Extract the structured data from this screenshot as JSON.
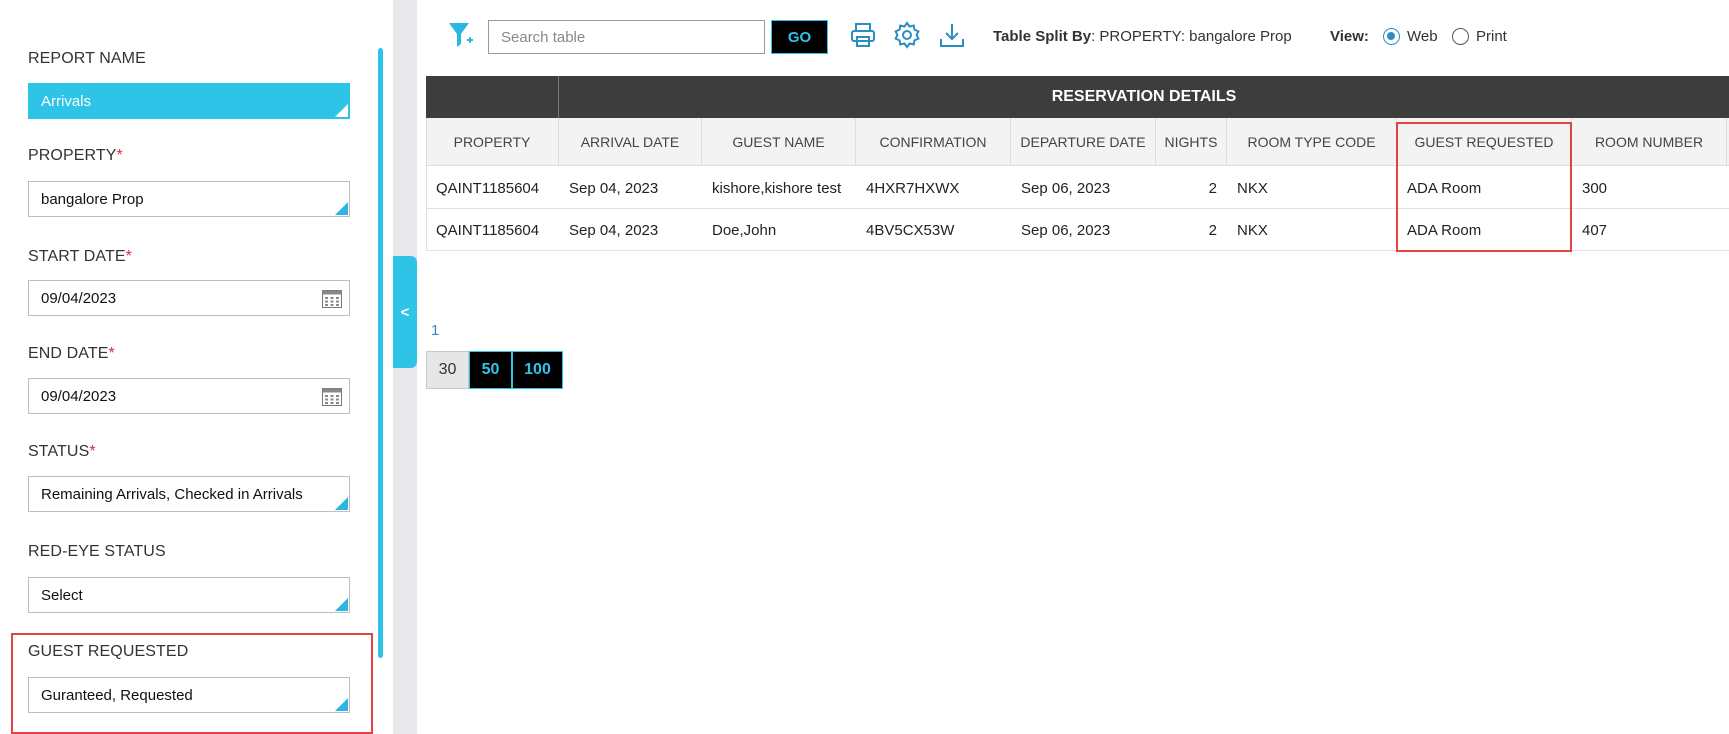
{
  "filters": {
    "report_name": {
      "label": "REPORT NAME",
      "value": "Arrivals"
    },
    "property": {
      "label": "PROPERTY",
      "required": "*",
      "value": "bangalore Prop"
    },
    "start_date": {
      "label": "START DATE",
      "required": "*",
      "value": "09/04/2023"
    },
    "end_date": {
      "label": "END DATE",
      "required": "*",
      "value": "09/04/2023"
    },
    "status": {
      "label": "STATUS",
      "required": "*",
      "value": "Remaining Arrivals, Checked in Arrivals"
    },
    "red_eye_status": {
      "label": "RED-EYE STATUS",
      "value": "Select"
    },
    "guest_requested": {
      "label": "GUEST REQUESTED",
      "value": "Guranteed, Requested"
    }
  },
  "panel": {
    "collapse_label": "<"
  },
  "toolbar": {
    "search_placeholder": "Search table",
    "go_label": "GO",
    "split_label": "Table Split By",
    "split_value": ": PROPERTY: bangalore Prop",
    "view_label": "View:",
    "view_options": [
      "Web",
      "Print"
    ],
    "view_selected": "Web"
  },
  "table": {
    "group_title": "RESERVATION DETAILS",
    "columns": [
      "PROPERTY",
      "ARRIVAL DATE",
      "GUEST NAME",
      "CONFIRMATION",
      "DEPARTURE DATE",
      "NIGHTS",
      "ROOM TYPE CODE",
      "GUEST REQUESTED",
      "ROOM NUMBER"
    ],
    "rows": [
      [
        "QAINT1185604",
        "Sep 04, 2023",
        "kishore,kishore test",
        "4HXR7HXWX",
        "Sep 06, 2023",
        "2",
        "NKX",
        "ADA Room",
        "300"
      ],
      [
        "QAINT1185604",
        "Sep 04, 2023",
        "Doe,John",
        "4BV5CX53W",
        "Sep 06, 2023",
        "2",
        "NKX",
        "ADA Room",
        "407"
      ]
    ]
  },
  "pagination": {
    "current_page": "1",
    "page_sizes": [
      "30",
      "50",
      "100"
    ],
    "selected_size": "30"
  },
  "colors": {
    "accent": "#2ec4e8",
    "header_dark": "#3d3d3d",
    "highlight": "#e04444"
  }
}
